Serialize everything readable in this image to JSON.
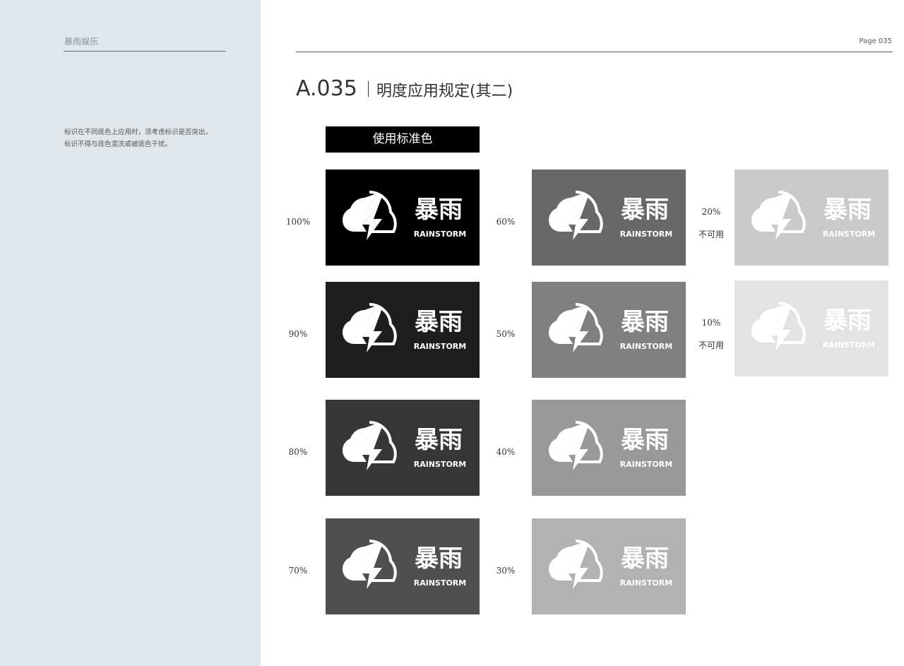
{
  "sidebar": {
    "brand": "暴雨娱乐",
    "description_lines": [
      "标识在不同底色上应用时，须考虑标识是否突出，",
      "标识不得与底色混洗或被底色干扰。"
    ]
  },
  "header": {
    "page": "Page 035",
    "code": "A.035",
    "title": "明度应用规定(其二)"
  },
  "standard_label": "使用标准色",
  "logo": {
    "cn": "暴雨",
    "en": "RAINSTORM",
    "icon": "cloud-lightning-icon"
  },
  "panels": [
    {
      "label": "100%",
      "note": "",
      "color": "#000000"
    },
    {
      "label": "90%",
      "note": "",
      "color": "#1e1e1e"
    },
    {
      "label": "80%",
      "note": "",
      "color": "#363636"
    },
    {
      "label": "70%",
      "note": "",
      "color": "#4f4f4f"
    },
    {
      "label": "60%",
      "note": "",
      "color": "#686868"
    },
    {
      "label": "50%",
      "note": "",
      "color": "#808080"
    },
    {
      "label": "40%",
      "note": "",
      "color": "#999999"
    },
    {
      "label": "30%",
      "note": "",
      "color": "#b2b2b2"
    },
    {
      "label": "20%",
      "note": "不可用",
      "color": "#cacaca"
    },
    {
      "label": "10%",
      "note": "不可用",
      "color": "#e3e3e3"
    }
  ]
}
